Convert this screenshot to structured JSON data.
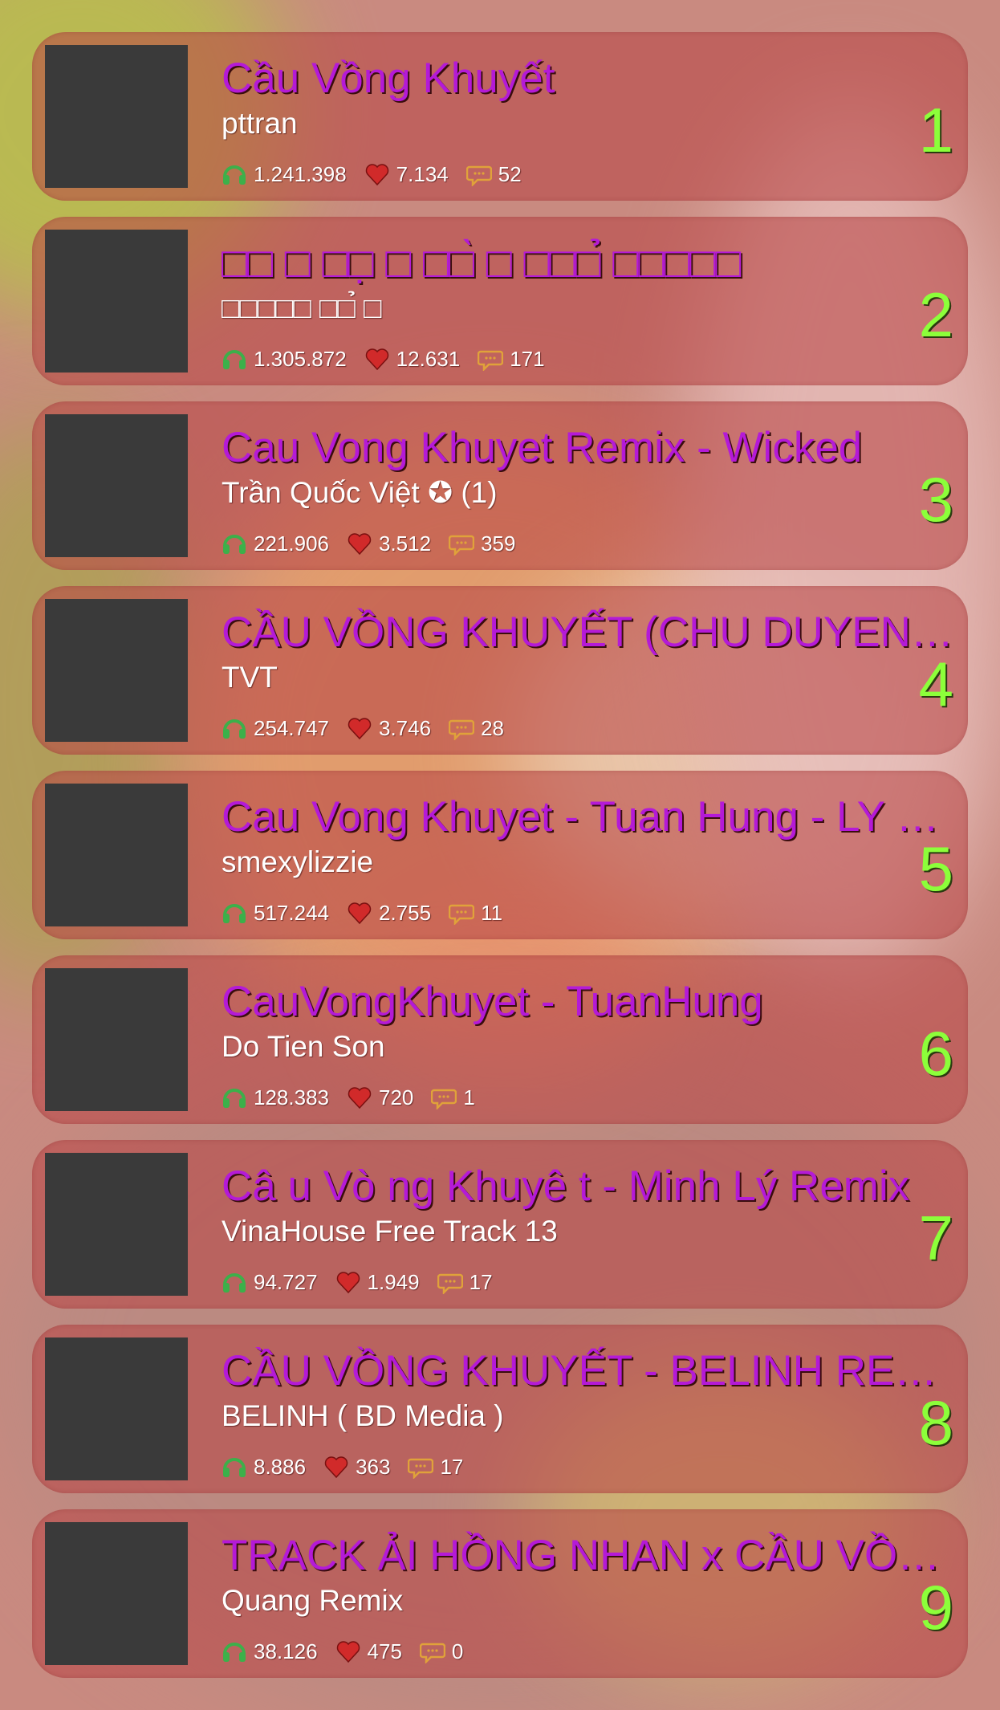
{
  "icons": {
    "listens": "headphones-icon",
    "likes": "heart-icon",
    "comments": "comment-icon"
  },
  "colors": {
    "title": "#b41ad7",
    "rank": "#8cff3a",
    "card": "#b84646",
    "thumb": "#3a3a3a",
    "headphones": "#3cb04a",
    "heart": "#d12a2a",
    "comment": "#e0a23a"
  },
  "tracks": [
    {
      "rank": "1",
      "title": "Cầu Vồng Khuyết",
      "artist": "pttran",
      "listens": "1.241.398",
      "likes": "7.134",
      "comments": "52"
    },
    {
      "rank": "2",
      "title": "□□ □ □□̣ □ □□̀ □ □□□̉ □□□□□",
      "artist": "□□□□□ □□̉ □",
      "listens": "1.305.872",
      "likes": "12.631",
      "comments": "171"
    },
    {
      "rank": "3",
      "title": "Cau Vong Khuyet Remix - Wicked",
      "artist": "Trần Quốc Việt ✪ (1)",
      "listens": "221.906",
      "likes": "3.512",
      "comments": "359"
    },
    {
      "rank": "4",
      "title": "CẦU VỒNG KHUYẾT (CHU DUYEN REMIX)",
      "artist": "TVT",
      "listens": "254.747",
      "likes": "3.746",
      "comments": "28"
    },
    {
      "rank": "5",
      "title": "Cau Vong Khuyet - Tuan Hung - LY REMIX",
      "artist": "smexylizzie",
      "listens": "517.244",
      "likes": "2.755",
      "comments": "11"
    },
    {
      "rank": "6",
      "title": "CauVongKhuyet - TuanHung",
      "artist": "Do Tien Son",
      "listens": "128.383",
      "likes": "720",
      "comments": "1"
    },
    {
      "rank": "7",
      "title": "Câ u Vò ng Khuyê t - Minh Lý  Remix",
      "artist": "VinaHouse Free Track 13",
      "listens": "94.727",
      "likes": "1.949",
      "comments": "17"
    },
    {
      "rank": "8",
      "title": "CẦU VỒNG KHUYẾT - BELINH REMIX",
      "artist": "BELINH ( BD Media )",
      "listens": "8.886",
      "likes": "363",
      "comments": "17"
    },
    {
      "rank": "9",
      "title": "TRACK ẢI HỒNG NHAN x CẦU VỒNG KHUYẾT",
      "artist": "Quang Remix",
      "listens": "38.126",
      "likes": "475",
      "comments": "0"
    }
  ]
}
